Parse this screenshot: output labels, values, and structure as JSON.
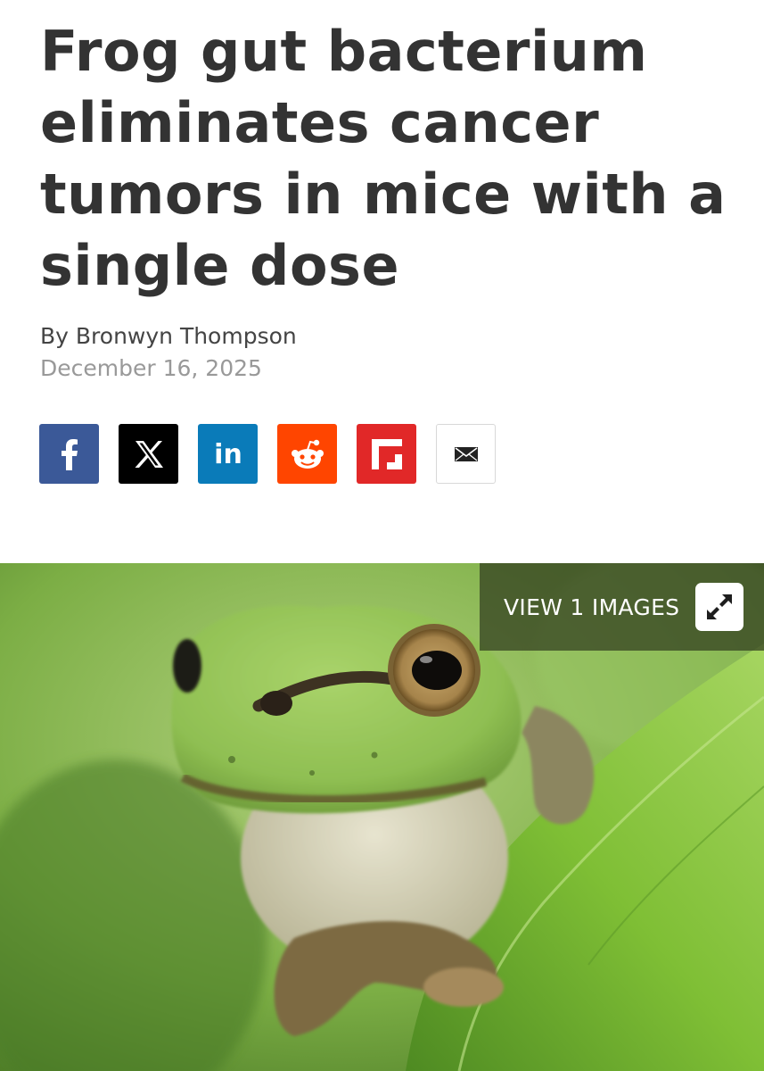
{
  "article": {
    "headline": "Frog gut bacterium eliminates cancer tumors in mice with a single dose",
    "byline": "By Bronwyn Thompson",
    "date": "December 16, 2025"
  },
  "share": {
    "buttons": [
      {
        "name": "facebook",
        "icon": "facebook-icon",
        "color": "#3b5998"
      },
      {
        "name": "x",
        "icon": "x-icon",
        "color": "#000000"
      },
      {
        "name": "linkedin",
        "icon": "linkedin-icon",
        "color": "#0a7bb9",
        "label": "in"
      },
      {
        "name": "reddit",
        "icon": "reddit-icon",
        "color": "#ff4500"
      },
      {
        "name": "flipboard",
        "icon": "flipboard-icon",
        "color": "#e12828"
      },
      {
        "name": "email",
        "icon": "envelope-icon",
        "color": "#ffffff"
      }
    ]
  },
  "hero": {
    "view_label": "VIEW 1 IMAGES",
    "expand_icon": "expand-icon"
  }
}
